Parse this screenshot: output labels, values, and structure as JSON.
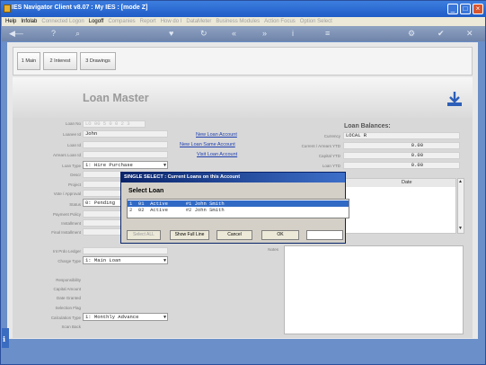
{
  "window": {
    "title": "IES Navigator Client v8.07 : My IES :      [mode Z]"
  },
  "menu": [
    {
      "label": "Help",
      "on": true
    },
    {
      "label": "Infolab",
      "on": true
    },
    {
      "label": "Connected Logon",
      "on": false
    },
    {
      "label": "Logoff",
      "on": true
    },
    {
      "label": "Companies",
      "on": false
    },
    {
      "label": "Report",
      "on": false
    },
    {
      "label": "How do I",
      "on": false
    },
    {
      "label": "DataMeter",
      "on": false
    },
    {
      "label": "Business Modules",
      "on": false
    },
    {
      "label": "Action Focus",
      "on": false
    },
    {
      "label": "Option Select",
      "on": false
    }
  ],
  "tabs": [
    {
      "label": "1 Main"
    },
    {
      "label": "2 Interest"
    },
    {
      "label": "3 Drawings"
    }
  ],
  "page": {
    "title": "Loan Master"
  },
  "fields": {
    "loan_no_label": "Loan No",
    "loan_no": "LO 00 5 0 0 2 3",
    "loanee_label": "Loanee Id",
    "loanee": "John",
    "loan_id_label": "Loan Id",
    "arrears_label": "Arrears Loan Id",
    "loan_type_label": "Loan Type",
    "loan_type": "1: Hire Purchase",
    "descr_label": "Descr",
    "project_label": "Project",
    "vote_label": "Vote / Approval",
    "status_label": "Status",
    "status": "0: Pending",
    "payment_policy_label": "Payment Policy",
    "installment_label": "Installment",
    "final_installment_label": "Final Installment",
    "ledger_label": "Int Prdo Ledger",
    "charge_type_label": "Charge Type",
    "charge_type": "1: Main Loan",
    "responsibility_label": "Responsibility",
    "capital_amount_label": "Capital Amount",
    "date_granted_label": "Date Granted",
    "selection_flag_label": "Selection Flag",
    "calc_type_label": "Calculation Type",
    "calc_type": "1: Monthly Advance",
    "scan_back_label": "Scan Back",
    "notes_label": "Notes"
  },
  "links": {
    "new_loan": "New Loan Account",
    "same_owner": "New Loan Same Account",
    "visit": "Visit Loan Account"
  },
  "balances": {
    "title": "Loan Balances:",
    "currency_label": "Currency",
    "currency": "LOCAL R",
    "current_label": "Current / Arrears YTD",
    "current": "0.00",
    "capital_label": "Capital YTD",
    "capital": "0.00",
    "loan_label": "Loan YTD",
    "loan": "0.00"
  },
  "grid": {
    "date_header": "Date"
  },
  "dialog": {
    "title": "SINGLE SELECT : Current Loans on this Account",
    "caption": "Select Loan",
    "rows": [
      "1  01  Active      #1 John Smith",
      "2  02  Active      #2 John Smith"
    ],
    "buttons": {
      "select_all": "Select ALL",
      "show_full": "Show Full Line",
      "cancel": "Cancel",
      "ok": "OK"
    }
  },
  "colors": {
    "titlebar": "#1f5cc6",
    "accent": "#316ac5",
    "link": "#2040b0"
  }
}
